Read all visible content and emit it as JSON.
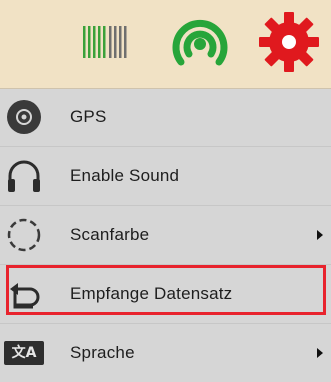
{
  "toolbar": {
    "icons": [
      "barcode-icon",
      "signal-icon",
      "gear-icon"
    ],
    "colors": {
      "barcode_green": "#3aa13a",
      "signal_green": "#27a53a",
      "gear_red": "#e0191e"
    }
  },
  "menu": {
    "items": [
      {
        "label": "GPS",
        "icon": "gps-icon",
        "has_submenu": false
      },
      {
        "label": "Enable Sound",
        "icon": "headphones-icon",
        "has_submenu": false
      },
      {
        "label": "Scanfarbe",
        "icon": "dashed-circle-icon",
        "has_submenu": true
      },
      {
        "label": "Empfange Datensatz",
        "icon": "receive-arrow-icon",
        "has_submenu": false,
        "highlighted": true
      },
      {
        "label": "Sprache",
        "icon": "translate-icon",
        "has_submenu": true
      }
    ]
  },
  "highlight_color": "#e8232d",
  "icon_glyphs": {
    "translate": "文A"
  }
}
